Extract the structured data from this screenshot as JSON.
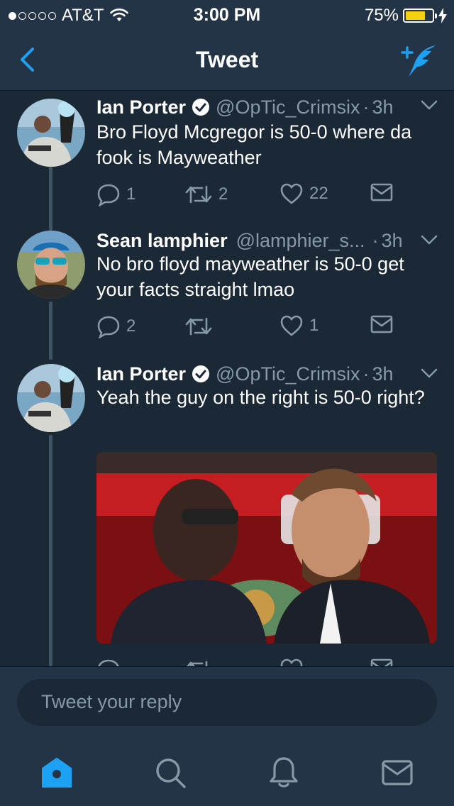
{
  "status_bar": {
    "carrier": "AT&T",
    "time": "3:00 PM",
    "battery": "75%",
    "battery_level": 0.75,
    "signal_bars": 1,
    "battery_color": "#f5d10f"
  },
  "nav": {
    "title": "Tweet",
    "back_icon": "chevron-left-icon",
    "compose_icon": "compose-tweet-icon",
    "accent": "#1da1f2"
  },
  "tweets": [
    {
      "name": "Ian Porter",
      "verified": true,
      "handle": "@OpTic_Crimsix",
      "dot": "·",
      "time": "3h",
      "text": "Bro Floyd Mcgregor is 50-0 where da fook is Mayweather",
      "replies": "1",
      "retweets": "2",
      "likes": "22"
    },
    {
      "name": "Sean lamphier",
      "verified": false,
      "handle": "@lamphier_s...",
      "dot": "·",
      "time": "3h",
      "text": "No bro floyd mayweather is 50-0 get your facts straight lmao",
      "replies": "2",
      "retweets": "",
      "likes": "1"
    },
    {
      "name": "Ian Porter",
      "verified": true,
      "handle": "@OpTic_Crimsix",
      "dot": "·",
      "time": "3h",
      "text": "Yeah the guy on the right is 50-0 right?",
      "has_media": true
    }
  ],
  "reply": {
    "placeholder": "Tweet your reply"
  },
  "tab_bar": {
    "items": [
      "home-icon",
      "search-icon",
      "notifications-icon",
      "messages-icon"
    ],
    "active": "home-icon"
  },
  "colors": {
    "background": "#1b2836",
    "bar": "#243447",
    "secondary_text": "#8899a6",
    "accent": "#1da1f2"
  }
}
